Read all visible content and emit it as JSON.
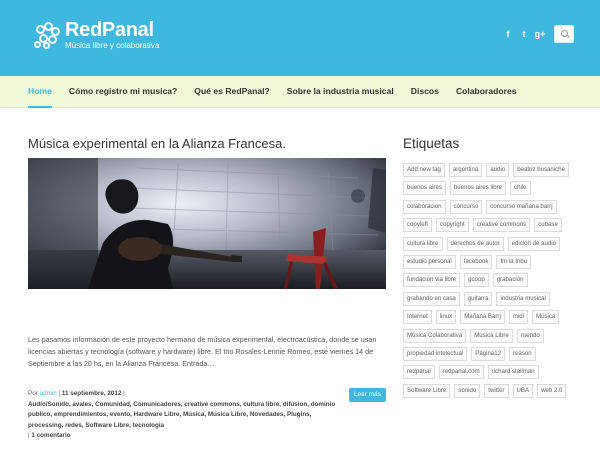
{
  "brand": {
    "name": "RedPanal",
    "tagline": "Música libre y colaborativa"
  },
  "social": [
    "f",
    "t",
    "g+"
  ],
  "nav": {
    "items": [
      "Home",
      "Cómo registro mi musica?",
      "Qué es RedPanal?",
      "Sobre la industria musical",
      "Discos",
      "Colaboradores"
    ],
    "active": 0
  },
  "post": {
    "title": "Música experimental en la Alianza Francesa.",
    "excerpt": "Les pasamos información de este proyecto hermano de música experimental, electroacústica, donde se usan licencias abiertas y tecnología (software y hardware) libre. El trio Rosales-Lennie Romeo, este viernes 14 de Septiembre a las 20 hs, en la Alianza Francesa. Entrada…",
    "read_more": "Leer más",
    "meta_prefix": "Por ",
    "author": "admin",
    "meta_sep": " | ",
    "date": "11 septiembre, 2012",
    "categories": "Audio/Sonido, avales, Comunidad, Comunicadores, creative commons, cultura libre, difusion, dominio publico, emprendimientos, evento, Hardware Libre, Música, Música Libre, Novedades, Plugins, processing, redes, Software Libre, tecnologia",
    "comments": "1 comentario"
  },
  "sidebar": {
    "title": "Etiquetas",
    "tags": [
      "Add new tag",
      "argentina",
      "audio",
      "beatriz busaniche",
      "buenos aires",
      "buenos aires libre",
      "chile",
      "colaboracion",
      "concurso",
      "concurso mañana barrj",
      "copyleft",
      "copyright",
      "creative commons",
      "cubase",
      "cultura libre",
      "derechos de autor",
      "edición de audio",
      "estudio personal",
      "facebook",
      "fm la tribu",
      "fundacion via libre",
      "gcoop",
      "grabación",
      "grabando en casa",
      "guitarra",
      "industria musical",
      "Internet",
      "linux",
      "Mañana Barrj",
      "midi",
      "Música",
      "Música Colaborativa",
      "Música Libre",
      "ruendo",
      "propiedad intelectual",
      "Página12",
      "reason",
      "redpanal",
      "redpanal.com",
      "richard stallman",
      "Software Libre",
      "sonido",
      "twitter",
      "UBA",
      "web 2.0"
    ]
  },
  "colors": {
    "accent": "#3fb8e0",
    "nav_bg": "#f0f8d8"
  }
}
